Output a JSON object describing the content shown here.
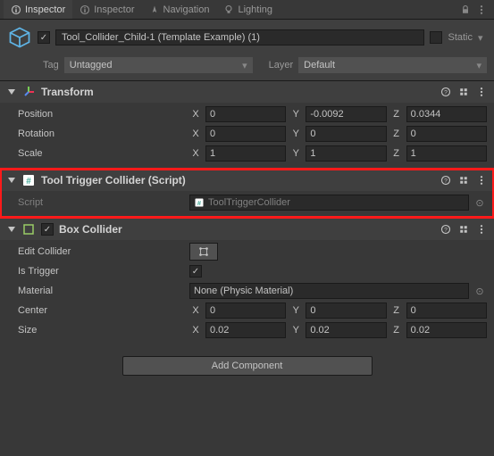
{
  "tabs": {
    "items": [
      {
        "label": "Inspector"
      },
      {
        "label": "Inspector"
      },
      {
        "label": "Navigation"
      },
      {
        "label": "Lighting"
      }
    ]
  },
  "gameobject": {
    "name": "Tool_Collider_Child-1 (Template Example) (1)",
    "static_label": "Static",
    "tag_label": "Tag",
    "tag_value": "Untagged",
    "layer_label": "Layer",
    "layer_value": "Default"
  },
  "transform": {
    "title": "Transform",
    "position": {
      "label": "Position",
      "x": "0",
      "y": "-0.0092",
      "z": "0.0344"
    },
    "rotation": {
      "label": "Rotation",
      "x": "0",
      "y": "0",
      "z": "0"
    },
    "scale": {
      "label": "Scale",
      "x": "1",
      "y": "1",
      "z": "1"
    }
  },
  "script_comp": {
    "title": "Tool Trigger Collider (Script)",
    "script_label": "Script",
    "script_value": "ToolTriggerCollider"
  },
  "box_collider": {
    "title": "Box Collider",
    "edit_label": "Edit Collider",
    "trigger_label": "Is Trigger",
    "material_label": "Material",
    "material_value": "None (Physic Material)",
    "center": {
      "label": "Center",
      "x": "0",
      "y": "0",
      "z": "0"
    },
    "size": {
      "label": "Size",
      "x": "0.02",
      "y": "0.02",
      "z": "0.02"
    }
  },
  "add_component": "Add Component",
  "axes": {
    "x": "X",
    "y": "Y",
    "z": "Z"
  }
}
